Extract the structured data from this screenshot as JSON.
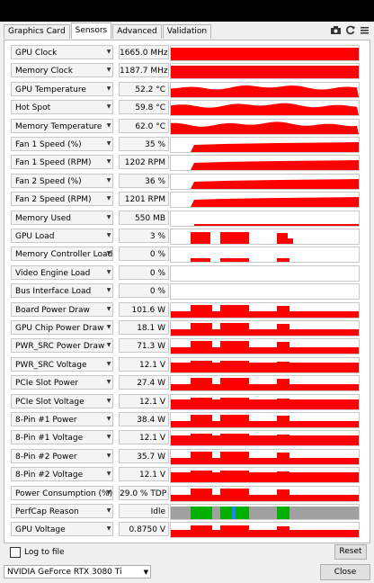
{
  "tabs": [
    "Graphics Card",
    "Sensors",
    "Advanced",
    "Validation"
  ],
  "active_tab": "Sensors",
  "icons": [
    "camera-icon",
    "refresh-icon",
    "menu-icon"
  ],
  "sensors": [
    {
      "label": "GPU Clock",
      "value": "1665.0 MHz",
      "graph": "full"
    },
    {
      "label": "Memory Clock",
      "value": "1187.7 MHz",
      "graph": "full"
    },
    {
      "label": "GPU Temperature",
      "value": "52.2 °C",
      "graph": "temp"
    },
    {
      "label": "Hot Spot",
      "value": "59.8 °C",
      "graph": "temp"
    },
    {
      "label": "Memory Temperature",
      "value": "62.0 °C",
      "graph": "temp"
    },
    {
      "label": "Fan 1 Speed (%)",
      "value": "35 %",
      "graph": "fan"
    },
    {
      "label": "Fan 1 Speed (RPM)",
      "value": "1202 RPM",
      "graph": "fan"
    },
    {
      "label": "Fan 2 Speed (%)",
      "value": "36 %",
      "graph": "fan"
    },
    {
      "label": "Fan 2 Speed (RPM)",
      "value": "1201 RPM",
      "graph": "fan"
    },
    {
      "label": "Memory Used",
      "value": "550 MB",
      "graph": "line"
    },
    {
      "label": "GPU Load",
      "value": "3 %",
      "graph": "load"
    },
    {
      "label": "Memory Controller Load",
      "value": "0 %",
      "graph": "memload"
    },
    {
      "label": "Video Engine Load",
      "value": "0 %",
      "graph": "empty"
    },
    {
      "label": "Bus Interface Load",
      "value": "0 %",
      "graph": "empty"
    },
    {
      "label": "Board Power Draw",
      "value": "101.6 W",
      "graph": "power"
    },
    {
      "label": "GPU Chip Power Draw",
      "value": "18.1 W",
      "graph": "power"
    },
    {
      "label": "PWR_SRC Power Draw",
      "value": "71.3 W",
      "graph": "power"
    },
    {
      "label": "PWR_SRC Voltage",
      "value": "12.1 V",
      "graph": "volt"
    },
    {
      "label": "PCIe Slot Power",
      "value": "27.4 W",
      "graph": "power"
    },
    {
      "label": "PCIe Slot Voltage",
      "value": "12.1 V",
      "graph": "volt"
    },
    {
      "label": "8-Pin #1 Power",
      "value": "38.4 W",
      "graph": "power"
    },
    {
      "label": "8-Pin #1 Voltage",
      "value": "12.1 V",
      "graph": "volt"
    },
    {
      "label": "8-Pin #2 Power",
      "value": "35.7 W",
      "graph": "power"
    },
    {
      "label": "8-Pin #2 Voltage",
      "value": "12.1 V",
      "graph": "volt"
    },
    {
      "label": "Power Consumption (%)",
      "value": "29.0 % TDP",
      "graph": "power"
    },
    {
      "label": "PerfCap Reason",
      "value": "Idle",
      "graph": "perfcap"
    },
    {
      "label": "GPU Voltage",
      "value": "0.8750 V",
      "graph": "gpuvolt"
    }
  ],
  "log_to_file": "Log to file",
  "reset": "Reset",
  "gpu_name": "NVIDIA GeForce RTX 3080 Ti",
  "close": "Close",
  "colors": {
    "graph": "#ff0000",
    "perfcap_green": "#00b000",
    "perfcap_gray": "#a0a0a0",
    "perfcap_blue": "#2080ff"
  }
}
